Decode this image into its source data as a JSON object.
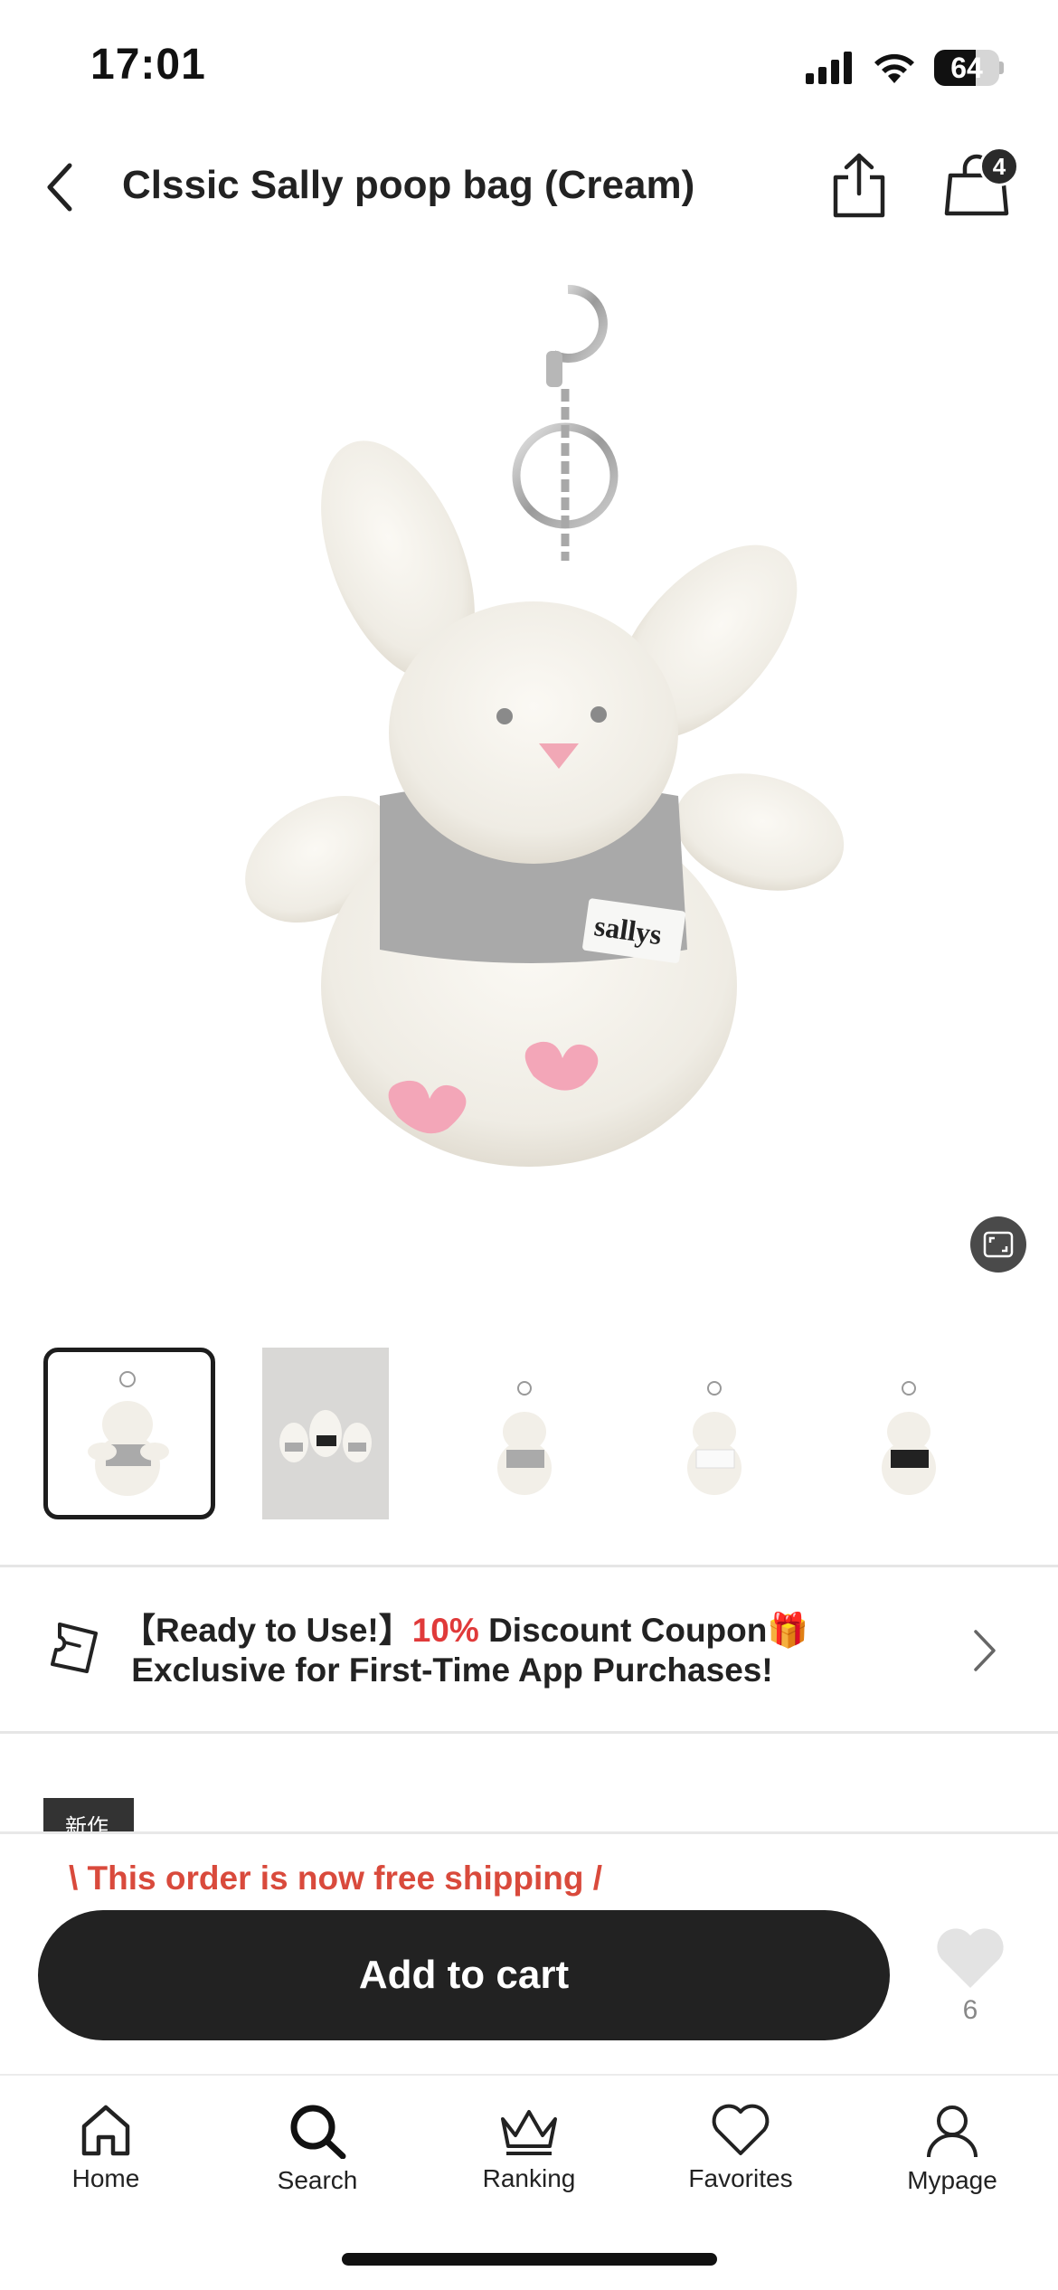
{
  "status_bar": {
    "time": "17:01",
    "battery_level": "64",
    "battery_fraction": 0.64,
    "icons": [
      "cellular-signal-icon",
      "wifi-icon",
      "battery-icon"
    ]
  },
  "header": {
    "title": "Clssic Sally poop bag (Cream)",
    "cart_badge": "4",
    "icons": [
      "back-chevron-icon",
      "share-icon",
      "shopping-bag-icon"
    ]
  },
  "product": {
    "brand_label": "sallys",
    "thumbnails": [
      "thumbnail-1",
      "thumbnail-2",
      "thumbnail-3",
      "thumbnail-4",
      "thumbnail-5"
    ],
    "selected_thumbnail": 0,
    "new_tag": "新作"
  },
  "coupon": {
    "line1_prefix": "【Ready to Use!】",
    "line1_highlight": "10%",
    "line1_suffix": " Discount Coupon🎁",
    "line2": " Exclusive for First-Time App Purchases!"
  },
  "purchase": {
    "free_shipping": "\\ This order is now free shipping /",
    "add_to_cart": "Add to cart",
    "favorite_count": "6"
  },
  "tabs": [
    {
      "label": "Home",
      "icon": "home-icon"
    },
    {
      "label": "Search",
      "icon": "search-icon"
    },
    {
      "label": "Ranking",
      "icon": "crown-icon"
    },
    {
      "label": "Favorites",
      "icon": "heart-icon"
    },
    {
      "label": "Mypage",
      "icon": "person-icon"
    }
  ],
  "colors": {
    "accent_red": "#e03a3a",
    "button_dark": "#222222"
  }
}
